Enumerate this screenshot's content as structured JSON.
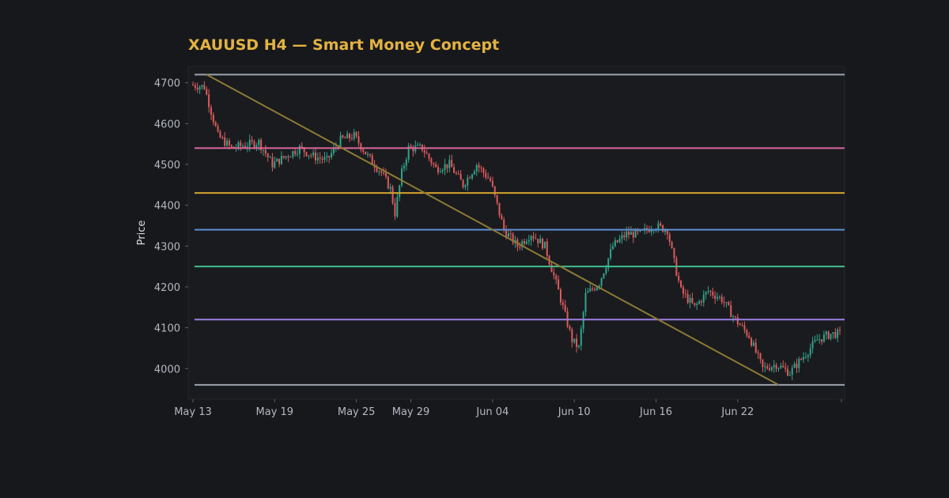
{
  "chart_data": {
    "type": "candlestick",
    "title": "XAUUSD H4 — Smart Money Concept",
    "xlabel": "",
    "ylabel": "Price",
    "ylim": [
      3925,
      4740
    ],
    "y_ticks": [
      4000,
      4100,
      4200,
      4300,
      4400,
      4500,
      4600,
      4700
    ],
    "x_range": [
      "2025-05-13",
      "2025-06-29"
    ],
    "x_ticks": [
      {
        "date": "2025-05-13",
        "label": "May 13"
      },
      {
        "date": "2025-05-19",
        "label": "May 19"
      },
      {
        "date": "2025-05-25",
        "label": "May 25"
      },
      {
        "date": "2025-05-29",
        "label": "May 29"
      },
      {
        "date": "2025-06-04",
        "label": "Jun 04"
      },
      {
        "date": "2025-06-10",
        "label": "Jun 10"
      },
      {
        "date": "2025-06-16",
        "label": "Jun 16"
      },
      {
        "date": "2025-06-22",
        "label": "Jun 22"
      }
    ],
    "grid": false,
    "candle_interval": "4H",
    "price_path": [
      [
        "2025-05-13",
        4695
      ],
      [
        "2025-05-14",
        4690
      ],
      [
        "2025-05-15",
        4570
      ],
      [
        "2025-05-16",
        4540
      ],
      [
        "2025-05-18",
        4555
      ],
      [
        "2025-05-19",
        4500
      ],
      [
        "2025-05-20",
        4520
      ],
      [
        "2025-05-21",
        4540
      ],
      [
        "2025-05-22",
        4520
      ],
      [
        "2025-05-23",
        4510
      ],
      [
        "2025-05-24",
        4560
      ],
      [
        "2025-05-25",
        4570
      ],
      [
        "2025-05-26",
        4520
      ],
      [
        "2025-05-27",
        4480
      ],
      [
        "2025-05-27T16:00",
        4440
      ],
      [
        "2025-05-28",
        4380
      ],
      [
        "2025-05-28T12:00",
        4480
      ],
      [
        "2025-05-29",
        4540
      ],
      [
        "2025-05-30",
        4540
      ],
      [
        "2025-05-31",
        4490
      ],
      [
        "2025-06-01",
        4500
      ],
      [
        "2025-06-02",
        4450
      ],
      [
        "2025-06-03",
        4500
      ],
      [
        "2025-06-04",
        4460
      ],
      [
        "2025-06-05",
        4340
      ],
      [
        "2025-06-06",
        4300
      ],
      [
        "2025-06-07",
        4330
      ],
      [
        "2025-06-08",
        4300
      ],
      [
        "2025-06-09",
        4190
      ],
      [
        "2025-06-10",
        4070
      ],
      [
        "2025-06-10T12:00",
        4050
      ],
      [
        "2025-06-11",
        4180
      ],
      [
        "2025-06-12",
        4210
      ],
      [
        "2025-06-13",
        4300
      ],
      [
        "2025-06-14",
        4330
      ],
      [
        "2025-06-15",
        4330
      ],
      [
        "2025-06-16",
        4350
      ],
      [
        "2025-06-17",
        4340
      ],
      [
        "2025-06-17T12:00",
        4260
      ],
      [
        "2025-06-18",
        4190
      ],
      [
        "2025-06-19",
        4150
      ],
      [
        "2025-06-20",
        4190
      ],
      [
        "2025-06-21",
        4170
      ],
      [
        "2025-06-22",
        4120
      ],
      [
        "2025-06-23",
        4080
      ],
      [
        "2025-06-24",
        4000
      ],
      [
        "2025-06-25",
        4010
      ],
      [
        "2025-06-26",
        3990
      ],
      [
        "2025-06-27",
        4030
      ],
      [
        "2025-06-28",
        4070
      ],
      [
        "2025-06-29",
        4085
      ]
    ],
    "levels": [
      {
        "value": 4720,
        "color": "#9ca3af"
      },
      {
        "value": 4540,
        "color": "#d9689a"
      },
      {
        "value": 4430,
        "color": "#d4a22e"
      },
      {
        "value": 4340,
        "color": "#5b8fd6"
      },
      {
        "value": 4250,
        "color": "#3fbf8f"
      },
      {
        "value": 4120,
        "color": "#9b7fe0"
      },
      {
        "value": 3960,
        "color": "#9ca3af"
      }
    ],
    "trendline": {
      "start": [
        "2025-05-14",
        4720
      ],
      "end": [
        "2025-06-25",
        3960
      ],
      "color": "#8c7a35"
    },
    "colors": {
      "up": "#2fa48c",
      "down": "#dc5b5b",
      "title": "#e3b341",
      "axis_text": "#b4b8c0",
      "background": "#17181c",
      "plot_background": "#1a1b1f"
    }
  }
}
